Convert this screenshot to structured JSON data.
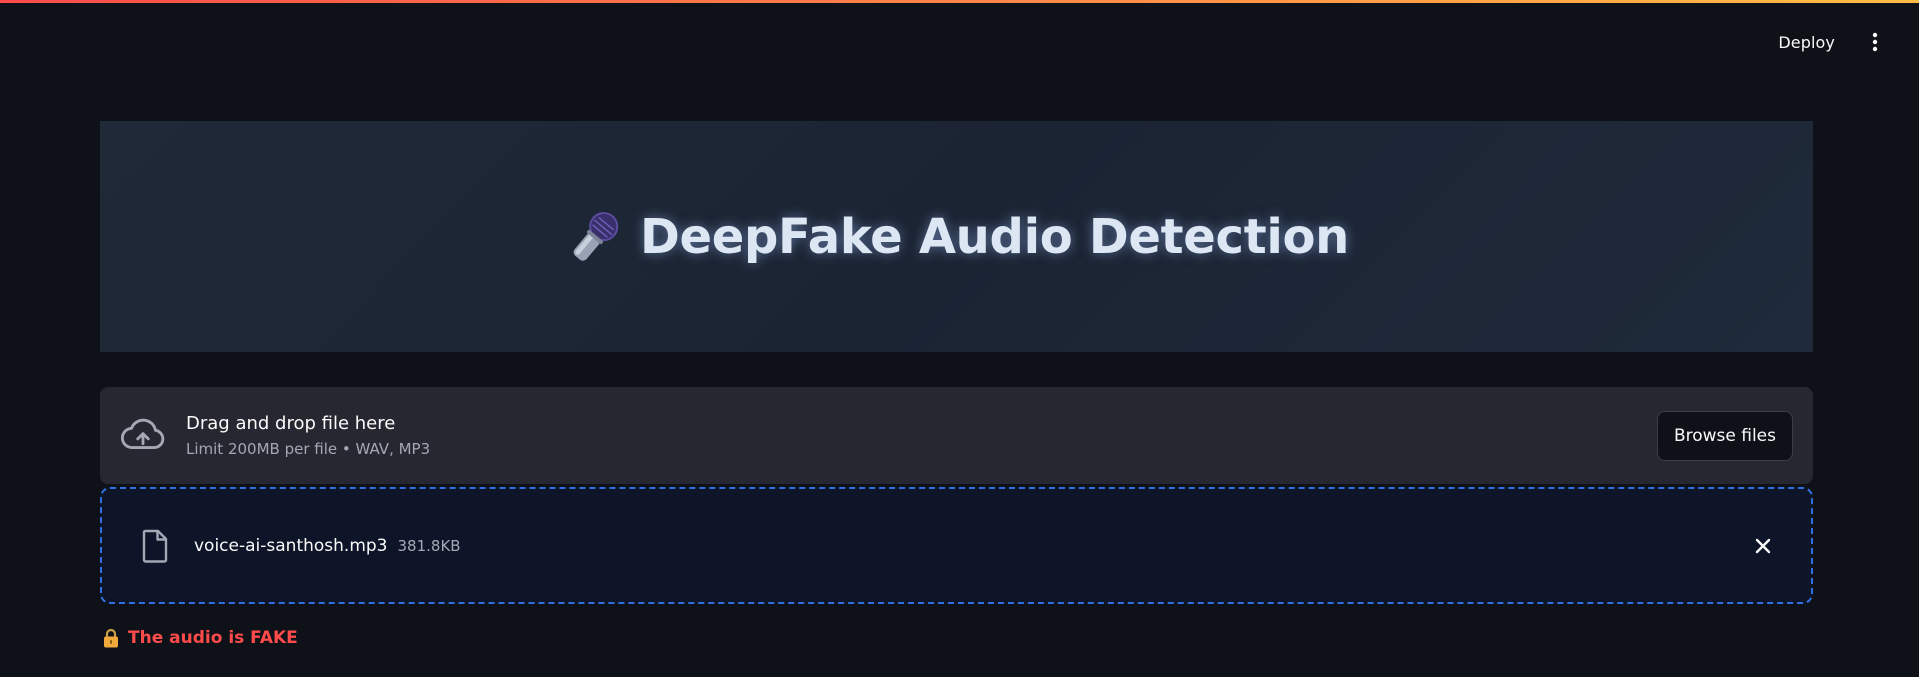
{
  "header": {
    "deploy_label": "Deploy",
    "menu_icon": "more-vertical-icon"
  },
  "hero": {
    "title": "DeepFake Audio Detection",
    "icon": "microphone-icon"
  },
  "uploader": {
    "icon": "cloud-upload-icon",
    "drop_label": "Drag and drop file here",
    "limit_label": "Limit 200MB per file • WAV, MP3",
    "browse_label": "Browse files"
  },
  "uploaded_file": {
    "icon": "file-icon",
    "name": "voice-ai-santhosh.mp3",
    "size": "381.8KB",
    "remove_icon": "close-icon"
  },
  "result": {
    "icon": "lock-icon",
    "text": "The audio is FAKE"
  },
  "colors": {
    "background": "#0e1117",
    "accent_red": "#ff4b4b",
    "accent_yellow": "#ffbd45",
    "dashed_border": "#2f6fe0"
  }
}
